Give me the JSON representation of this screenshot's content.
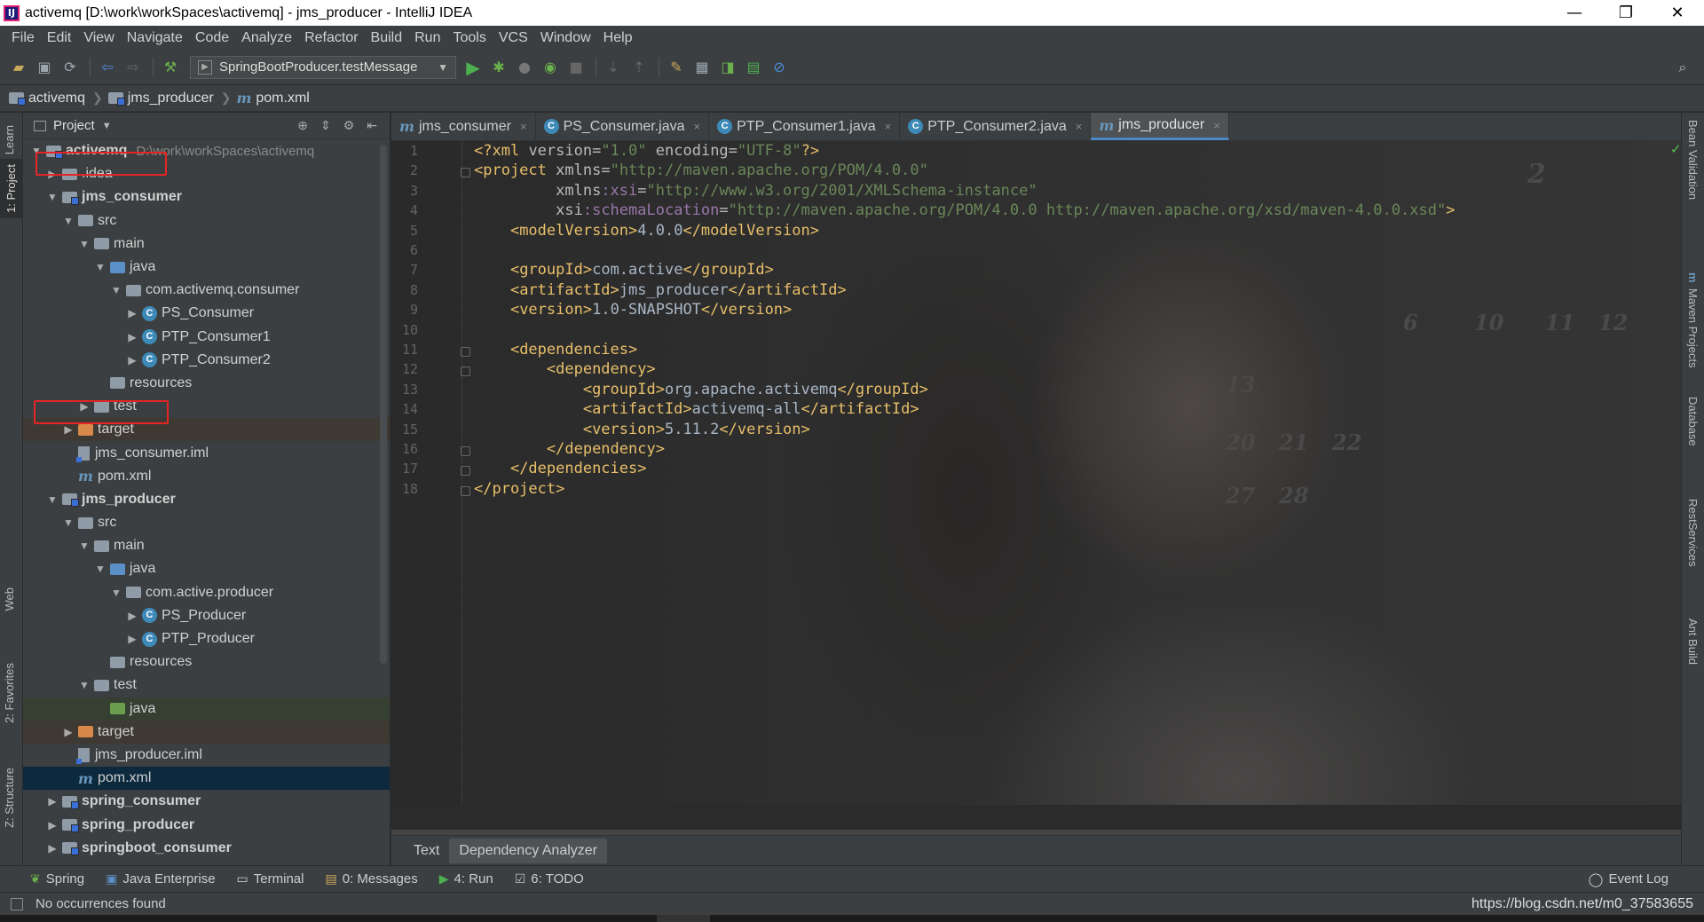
{
  "window": {
    "title": "activemq [D:\\work\\workSpaces\\activemq] - jms_producer - IntelliJ IDEA",
    "app_icon_label": "IJ",
    "minimize": "—",
    "restore": "❐",
    "close": "✕"
  },
  "menu": [
    "File",
    "Edit",
    "View",
    "Navigate",
    "Code",
    "Analyze",
    "Refactor",
    "Build",
    "Run",
    "Tools",
    "VCS",
    "Window",
    "Help"
  ],
  "toolbar": {
    "run_config": "SpringBootProducer.testMessage"
  },
  "breadcrumb": [
    {
      "label": "activemq",
      "icon": "folder-module-icon"
    },
    {
      "label": "jms_producer",
      "icon": "folder-module-icon"
    },
    {
      "label": "pom.xml",
      "icon": "maven-icon"
    }
  ],
  "left_tool_tabs": {
    "learn": "Learn",
    "project": "1: Project",
    "web": "Web",
    "favorites": "2: Favorites",
    "structure": "Z: Structure"
  },
  "right_tool_tabs": {
    "bean_validation": "Bean Validation",
    "maven": "Maven Projects",
    "database": "Database",
    "rest": "RestServices",
    "ant": "Ant Build"
  },
  "project_panel": {
    "title": "Project",
    "tree": [
      {
        "label": "activemq",
        "path": "D:\\work\\workSpaces\\activemq",
        "bold": true
      },
      {
        "label": ".idea"
      },
      {
        "label": "jms_consumer",
        "bold": true
      },
      {
        "label": "src"
      },
      {
        "label": "main"
      },
      {
        "label": "java"
      },
      {
        "label": "com.activemq.consumer"
      },
      {
        "label": "PS_Consumer"
      },
      {
        "label": "PTP_Consumer1"
      },
      {
        "label": "PTP_Consumer2"
      },
      {
        "label": "resources"
      },
      {
        "label": "test"
      },
      {
        "label": "target"
      },
      {
        "label": "jms_consumer.iml"
      },
      {
        "label": "pom.xml"
      },
      {
        "label": "jms_producer",
        "bold": true
      },
      {
        "label": "src"
      },
      {
        "label": "main"
      },
      {
        "label": "java"
      },
      {
        "label": "com.active.producer"
      },
      {
        "label": "PS_Producer"
      },
      {
        "label": "PTP_Producer"
      },
      {
        "label": "resources"
      },
      {
        "label": "test"
      },
      {
        "label": "java"
      },
      {
        "label": "target"
      },
      {
        "label": "jms_producer.iml"
      },
      {
        "label": "pom.xml"
      },
      {
        "label": "spring_consumer",
        "bold": true
      },
      {
        "label": "spring_producer",
        "bold": true
      },
      {
        "label": "springboot_consumer",
        "bold": true
      }
    ]
  },
  "editor_tabs": [
    {
      "label": "jms_consumer",
      "icon": "maven-icon",
      "close": "×"
    },
    {
      "label": "PS_Consumer.java",
      "icon": "class-icon",
      "close": "×"
    },
    {
      "label": "PTP_Consumer1.java",
      "icon": "class-icon",
      "close": "×"
    },
    {
      "label": "PTP_Consumer2.java",
      "icon": "class-icon",
      "close": "×"
    },
    {
      "label": "jms_producer",
      "icon": "maven-icon",
      "close": "×",
      "active": true
    }
  ],
  "editor": {
    "line_numbers": [
      "1",
      "2",
      "3",
      "4",
      "5",
      "6",
      "7",
      "8",
      "9",
      "10",
      "11",
      "12",
      "13",
      "14",
      "15",
      "16",
      "17",
      "18"
    ],
    "lines": [
      "<?xml version=\"1.0\" encoding=\"UTF-8\"?>",
      "<project xmlns=\"http://maven.apache.org/POM/4.0.0\"",
      "         xmlns:xsi=\"http://www.w3.org/2001/XMLSchema-instance\"",
      "         xsi:schemaLocation=\"http://maven.apache.org/POM/4.0.0 http://maven.apache.org/xsd/maven-4.0.0.xsd\">",
      "    <modelVersion>4.0.0</modelVersion>",
      "",
      "    <groupId>com.active</groupId>",
      "    <artifactId>jms_producer</artifactId>",
      "    <version>1.0-SNAPSHOT</version>",
      "",
      "    <dependencies>",
      "        <dependency>",
      "            <groupId>org.apache.activemq</groupId>",
      "            <artifactId>activemq-all</artifactId>",
      "            <version>5.11.2</version>",
      "        </dependency>",
      "    </dependencies>",
      "</project>"
    ],
    "bottom_tabs": [
      "Text",
      "Dependency Analyzer"
    ]
  },
  "tool_windows": [
    {
      "label": "Spring",
      "icon": "spring-icon"
    },
    {
      "label": "Java Enterprise",
      "icon": "java-enterprise-icon"
    },
    {
      "label": "Terminal",
      "icon": "terminal-icon"
    },
    {
      "label": "0: Messages",
      "icon": "messages-icon"
    },
    {
      "label": "4: Run",
      "icon": "run-icon"
    },
    {
      "label": "6: TODO",
      "icon": "todo-icon"
    }
  ],
  "event_log": "Event Log",
  "status": {
    "message": "No occurrences found",
    "url": "https://blog.csdn.net/m0_37583655"
  },
  "colors": {
    "tag": "#e8bf6a",
    "attr_value": "#6a8759",
    "namespace": "#9876aa",
    "highlight_box": "#e52525",
    "selection": "#0d293e"
  }
}
